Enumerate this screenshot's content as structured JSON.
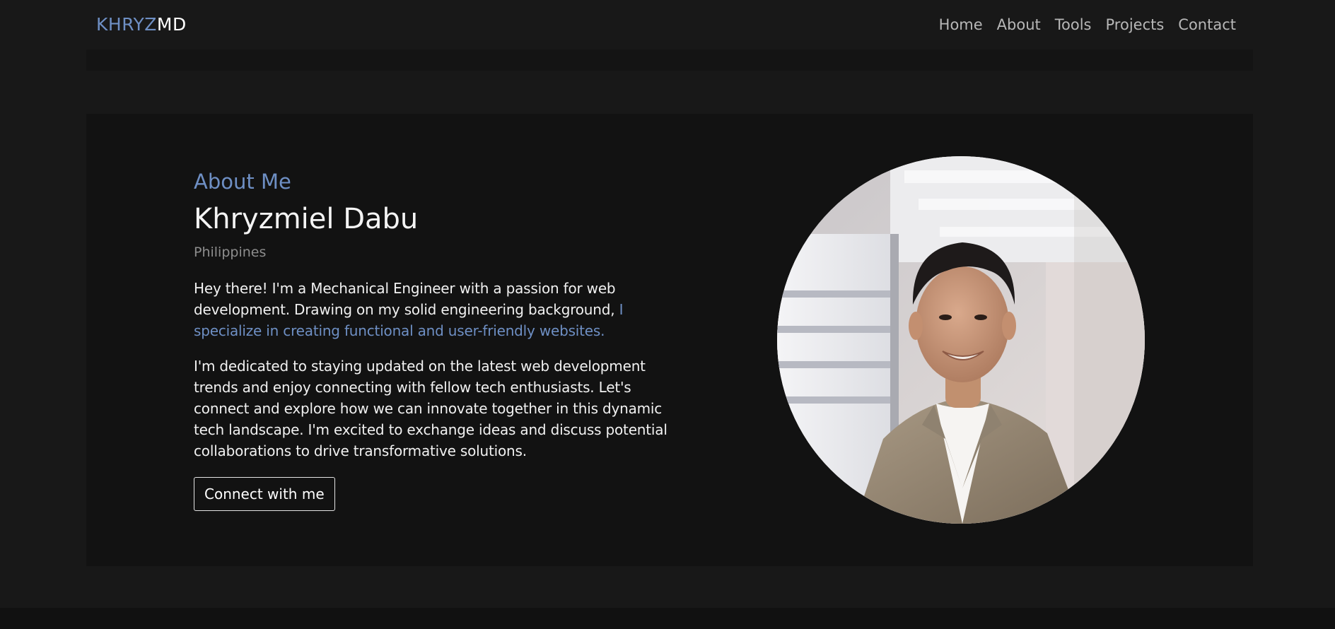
{
  "brand": {
    "part1": "KHRYZ",
    "part2": "MD"
  },
  "nav": {
    "items": [
      {
        "label": "Home"
      },
      {
        "label": "About"
      },
      {
        "label": "Tools"
      },
      {
        "label": "Projects"
      },
      {
        "label": "Contact"
      }
    ]
  },
  "about": {
    "section_label": "About Me",
    "name": "Khryzmiel Dabu",
    "location": "Philippines",
    "paragraph1_main": "Hey there! I'm a Mechanical Engineer with a passion for web development. Drawing on my solid engineering background, ",
    "paragraph1_accent": "I specialize in creating functional and user-friendly websites.",
    "paragraph2": "I'm dedicated to staying updated on the latest web development trends and enjoy connecting with fellow tech enthusiasts. Let's connect and explore how we can innovate together in this dynamic tech landscape. I'm excited to exchange ideas and discuss potential collaborations to drive transformative solutions.",
    "cta_label": "Connect with me"
  },
  "colors": {
    "background": "#181818",
    "card": "#121212",
    "accent": "#6e8fc4",
    "text": "#f1f1f1",
    "muted": "#8d8d8d"
  }
}
